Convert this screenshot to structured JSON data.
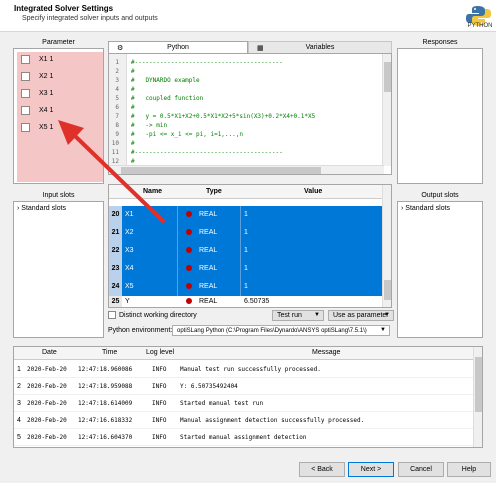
{
  "header": {
    "title": "Integrated Solver Settings",
    "subtitle": "Specify integrated solver inputs and outputs",
    "logo_text": "PYTHON"
  },
  "sections": {
    "parameter": "Parameter",
    "responses": "Responses",
    "input_slots": "Input slots",
    "output_slots": "Output slots"
  },
  "parameters": [
    "X1  1",
    "X2  1",
    "X3  1",
    "X4  1",
    "X5  1"
  ],
  "tabs": {
    "python": "Python",
    "variables": "Variables"
  },
  "code": {
    "line_numbers": [
      "1",
      "2",
      "3",
      "4",
      "5",
      "6",
      "7",
      "8",
      "9",
      "10",
      "11",
      "12"
    ],
    "lines": [
      "#-----------------------------------------",
      "#",
      "#   DYNARDO example",
      "#",
      "#   coupled function",
      "#",
      "#   y = 0.5*X1+X2+0.5*X1*X2+5*sin(X3)+0.2*X4+0.1*X5",
      "#   -> min",
      "#   -pi <= x_i <= pi, i=1,...,n",
      "#",
      "#-----------------------------------------",
      "#"
    ]
  },
  "input_slots": "Standard slots",
  "output_slots": "Standard slots",
  "var_table": {
    "headers": {
      "name": "Name",
      "type": "Type",
      "value": "Value"
    },
    "rows": [
      {
        "num": "20",
        "name": "X1",
        "type": "REAL",
        "value": "1"
      },
      {
        "num": "21",
        "name": "X2",
        "type": "REAL",
        "value": "1"
      },
      {
        "num": "22",
        "name": "X3",
        "type": "REAL",
        "value": "1"
      },
      {
        "num": "23",
        "name": "X4",
        "type": "REAL",
        "value": "1"
      },
      {
        "num": "24",
        "name": "X5",
        "type": "REAL",
        "value": "1"
      },
      {
        "num": "25",
        "name": "Y",
        "type": "REAL",
        "value": "6.50735"
      }
    ]
  },
  "options": {
    "distinct_dir": "Distinct working directory",
    "test_run": "Test run",
    "use_as_parameter": "Use as parameter",
    "env_label": "Python environment:",
    "env_value": "optiSLang Python (C:\\Program Files\\Dynardo\\ANSYS optiSLang\\7.5.1\\)"
  },
  "log": {
    "headers": {
      "date": "Date",
      "time": "Time",
      "level": "Log level",
      "message": "Message"
    },
    "rows": [
      {
        "num": "1",
        "date": "2020-Feb-20",
        "time": "12:47:18.960086",
        "level": "INFO",
        "message": "Manual test run successfully processed."
      },
      {
        "num": "2",
        "date": "2020-Feb-20",
        "time": "12:47:18.959088",
        "level": "INFO",
        "message": "Y: 6.50735492404"
      },
      {
        "num": "3",
        "date": "2020-Feb-20",
        "time": "12:47:18.614009",
        "level": "INFO",
        "message": "Started manual test run"
      },
      {
        "num": "4",
        "date": "2020-Feb-20",
        "time": "12:47:16.618332",
        "level": "INFO",
        "message": "Manual assignment detection successfully processed."
      },
      {
        "num": "5",
        "date": "2020-Feb-20",
        "time": "12:47:16.604370",
        "level": "INFO",
        "message": "Started manual assignment detection"
      }
    ]
  },
  "buttons": {
    "back": "< Back",
    "next": "Next >",
    "cancel": "Cancel",
    "help": "Help"
  },
  "colors": {
    "accent": "#0078d7",
    "param_highlight": "#f4c6c6",
    "arrow": "#e0302a",
    "dot": "#c00000"
  }
}
